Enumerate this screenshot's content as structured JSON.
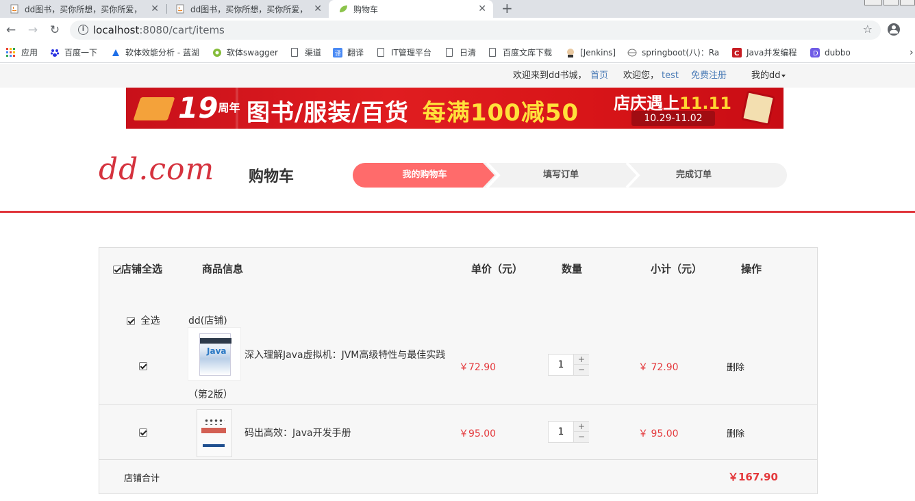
{
  "browser": {
    "tabs": [
      {
        "title": "dd图书，买你所想，买你所爱，",
        "active": false
      },
      {
        "title": "dd图书，买你所想，买你所爱，",
        "active": false
      },
      {
        "title": "购物车",
        "active": true
      }
    ],
    "new_tab": "+",
    "url": {
      "host": "localhost",
      "rest": ":8080/cart/items"
    },
    "bookmarks": [
      "应用",
      "百度一下",
      "软体效能分析 - 蓝湖",
      "软体swagger",
      "渠道",
      "翻译",
      "IT管理平台",
      "日清",
      "百度文库下载",
      "[Jenkins]",
      "springboot(八)：Ra",
      "Java并发编程",
      "dubbo"
    ],
    "more_bookmarks": "›"
  },
  "topnav": {
    "welcome": "欢迎来到dd书城，",
    "home": "首页",
    "hello": "欢迎您，",
    "user": "test",
    "register": "免费注册",
    "my": "我的dd"
  },
  "banner": {
    "anniversary": "19",
    "anniversary_suffix": "周年",
    "headline": "图书/服装/百货",
    "offer": "每满100减50",
    "sale": "店庆遇上",
    "sale_date_mark": "11.11",
    "dates": "10.29-11.02"
  },
  "brand": {
    "logo": "dd.com",
    "page_title": "购物车"
  },
  "steps": [
    "我的购物车",
    "填写订单",
    "完成订单"
  ],
  "colors": {
    "accent": "#e0353b",
    "price": "#e4393c",
    "step_active": "#ff6b6b",
    "link": "#4d7db7"
  },
  "cart": {
    "headers": {
      "select_all": "店铺全选",
      "info": "商品信息",
      "unit_price": "单价（元）",
      "quantity": "数量",
      "subtotal": "小计（元）",
      "action": "操作"
    },
    "shop": {
      "select_all": "全选",
      "name": "dd(店铺)"
    },
    "items": [
      {
        "title": "深入理解Java虚拟机：JVM高级特性与最佳实践",
        "title_cont": "（第2版）",
        "price": "￥72.90",
        "qty": "1",
        "subtotal": "￥ 72.90",
        "action": "删除"
      },
      {
        "title": "码出高效：Java开发手册",
        "price": "￥95.00",
        "qty": "1",
        "subtotal": "￥ 95.00",
        "action": "删除"
      }
    ],
    "shop_total_label": "店铺合计",
    "shop_total": "￥167.90",
    "plus": "+",
    "minus": "−"
  }
}
